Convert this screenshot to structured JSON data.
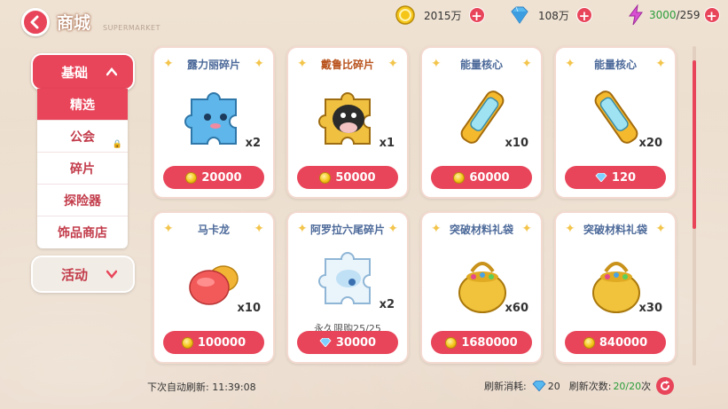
{
  "header": {
    "title": "商城",
    "subtitle": "SUPERMARKET"
  },
  "resources": [
    {
      "icon": "gold-coin-icon",
      "value": "2015万"
    },
    {
      "icon": "diamond-icon",
      "value": "108万"
    },
    {
      "icon": "energy-icon",
      "value_current": "3000",
      "value_max": "/259"
    }
  ],
  "sidebar": {
    "basic_label": "基础",
    "items": [
      {
        "label": "精选",
        "active": true
      },
      {
        "label": "公会",
        "locked": true
      },
      {
        "label": "碎片"
      },
      {
        "label": "探险器"
      },
      {
        "label": "饰品商店"
      }
    ],
    "activity_label": "活动"
  },
  "products": [
    {
      "name": "露力丽碎片",
      "name_style": "blue",
      "icon": "blue-puzzle-piece-icon",
      "qty": "x2",
      "currency": "coin",
      "price": "20000"
    },
    {
      "name": "戴鲁比碎片",
      "name_style": "gold",
      "icon": "cow-puzzle-piece-icon",
      "qty": "x1",
      "currency": "coin",
      "price": "50000"
    },
    {
      "name": "能量核心",
      "name_style": "blue",
      "icon": "energy-core-icon",
      "qty": "x10",
      "currency": "coin",
      "price": "60000"
    },
    {
      "name": "能量核心",
      "name_style": "blue",
      "icon": "energy-core-icon",
      "qty": "x20",
      "currency": "gem",
      "price": "120"
    },
    {
      "name": "马卡龙",
      "name_style": "blue",
      "icon": "macaron-icon",
      "qty": "x10",
      "currency": "coin",
      "price": "100000"
    },
    {
      "name": "阿罗拉六尾碎片",
      "name_style": "blue",
      "icon": "white-puzzle-piece-icon",
      "qty": "x2",
      "limit": "永久限购25/25",
      "currency": "gem",
      "price": "30000"
    },
    {
      "name": "突破材料礼袋",
      "name_style": "blue",
      "icon": "gift-bag-icon",
      "qty": "x60",
      "currency": "coin",
      "price": "1680000"
    },
    {
      "name": "突破材料礼袋",
      "name_style": "blue",
      "icon": "gift-bag-icon",
      "qty": "x30",
      "currency": "coin",
      "price": "840000"
    }
  ],
  "footer": {
    "auto_refresh_label": "下次自动刷新:",
    "auto_refresh_time": "11:39:08",
    "refresh_cost_label": "刷新消耗:",
    "refresh_cost": "20",
    "refresh_count_label": "刷新次数:",
    "refresh_count": "20/20",
    "refresh_count_suffix": "次"
  },
  "colors": {
    "accent": "#e8455a",
    "card_border": "#f3d9cf",
    "name_blue": "#4d6a9a",
    "name_gold": "#b9531d"
  }
}
